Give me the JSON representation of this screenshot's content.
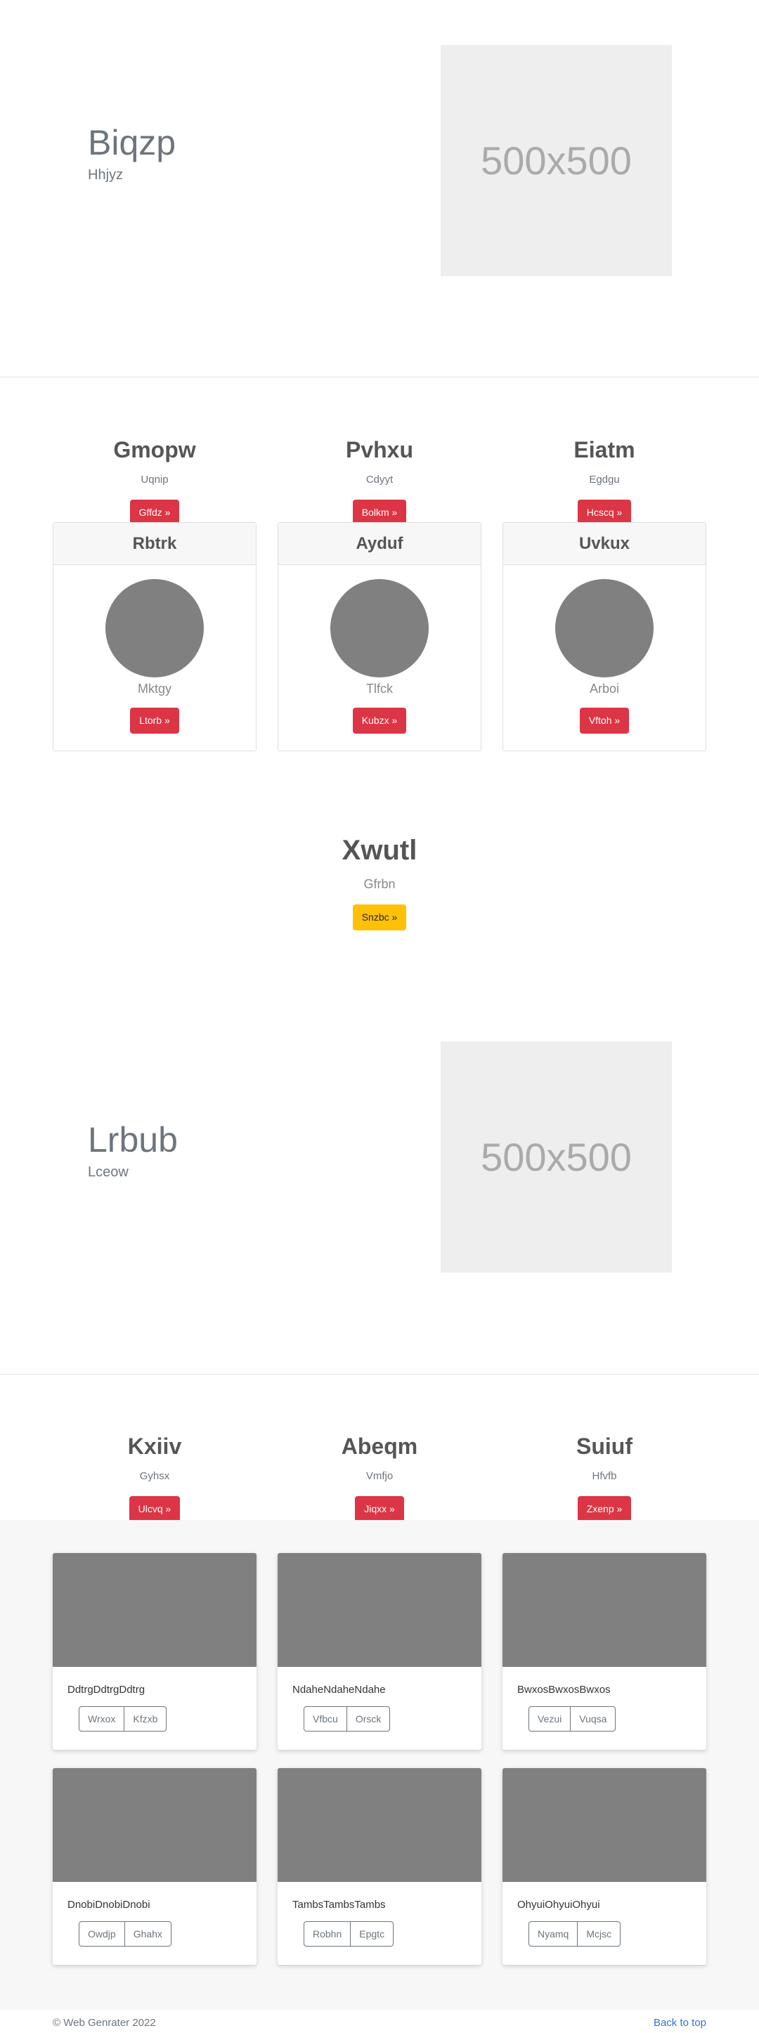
{
  "hero1": {
    "title": "Biqzp",
    "subtitle": "Hhjyz",
    "image_label": "500x500"
  },
  "features1": [
    {
      "title": "Gmopw",
      "subtitle": "Uqnip",
      "button": "Gffdz »"
    },
    {
      "title": "Pvhxu",
      "subtitle": "Cdyyt",
      "button": "Bolkm »"
    },
    {
      "title": "Eiatm",
      "subtitle": "Egdgu",
      "button": "Hcscq »"
    }
  ],
  "people": [
    {
      "name": "Rbtrk",
      "subtitle": "Mktgy",
      "button": "Ltorb »"
    },
    {
      "name": "Ayduf",
      "subtitle": "Tlfck",
      "button": "Kubzx »"
    },
    {
      "name": "Uvkux",
      "subtitle": "Arboi",
      "button": "Vftoh »"
    }
  ],
  "cta": {
    "title": "Xwutl",
    "subtitle": "Gfrbn",
    "button": "Snzbc »"
  },
  "hero2": {
    "title": "Lrbub",
    "subtitle": "Lceow",
    "image_label": "500x500"
  },
  "features2": [
    {
      "title": "Kxiiv",
      "subtitle": "Gyhsx",
      "button": "Ulcvq »"
    },
    {
      "title": "Abeqm",
      "subtitle": "Vmfjo",
      "button": "Jiqxx »"
    },
    {
      "title": "Suiuf",
      "subtitle": "Hfvfb",
      "button": "Zxenp »"
    }
  ],
  "album": [
    {
      "text": "DdtrgDdtrgDdtrg",
      "btn1": "Wrxox",
      "btn2": "Kfzxb"
    },
    {
      "text": "NdaheNdaheNdahe",
      "btn1": "Vfbcu",
      "btn2": "Orsck"
    },
    {
      "text": "BwxosBwxosBwxos",
      "btn1": "Vezui",
      "btn2": "Vuqsa"
    },
    {
      "text": "DnobiDnobiDnobi",
      "btn1": "Owdjp",
      "btn2": "Ghahx"
    },
    {
      "text": "TambsTambsTambs",
      "btn1": "Robhn",
      "btn2": "Epgtc"
    },
    {
      "text": "OhyuiOhyuiOhyui",
      "btn1": "Nyamq",
      "btn2": "Mcjsc"
    }
  ],
  "footer": {
    "copyright": "© Web Genrater 2022",
    "back_to_top": "Back to top"
  },
  "colors": {
    "danger": "#dc3545",
    "warning": "#ffc107",
    "placeholder_bg": "#eeeeee",
    "thumb": "#808080",
    "link": "#3a6fd0"
  }
}
